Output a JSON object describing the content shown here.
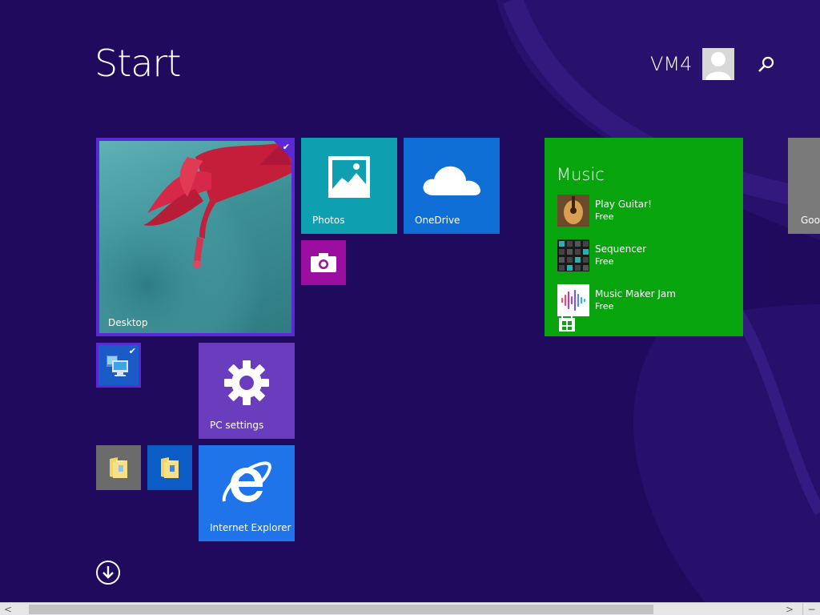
{
  "header": {
    "title": "Start",
    "user_name": "VM4"
  },
  "tiles": {
    "desktop": {
      "label": "Desktop",
      "icon": "flower-wallpaper",
      "selected": true
    },
    "photos": {
      "label": "Photos",
      "icon": "photos-icon"
    },
    "onedrive": {
      "label": "OneDrive",
      "icon": "cloud-icon"
    },
    "camera": {
      "icon": "camera-icon"
    },
    "computer": {
      "icon": "computer-icon",
      "selected": true
    },
    "pc_settings": {
      "label": "PC settings",
      "icon": "gear-icon"
    },
    "folder1": {
      "icon": "folder-icon"
    },
    "folder2": {
      "icon": "folder-icon"
    },
    "internet_explorer": {
      "label": "Internet Explorer",
      "icon": "ie-icon"
    },
    "google": {
      "label": "Goog"
    }
  },
  "music": {
    "title": "Music",
    "items": [
      {
        "name": "Play Guitar!",
        "price": "Free",
        "icon": "guitar-icon"
      },
      {
        "name": "Sequencer",
        "price": "Free",
        "icon": "sequencer-icon"
      },
      {
        "name": "Music Maker Jam",
        "price": "Free",
        "icon": "waveform-icon"
      }
    ],
    "store_icon": "windows-store-icon"
  },
  "colors": {
    "background": "#1f0a5e",
    "accent": "#5b2ad6",
    "photos": "#0e9fb0",
    "onedrive": "#0f6fd6",
    "camera": "#9c0ea0",
    "pc_settings": "#6a3dbf",
    "ie": "#1e74e8",
    "music": "#08a40d"
  },
  "scrollbar": {
    "left_arrow": "<",
    "right_arrow": ">",
    "min_button": "−"
  }
}
